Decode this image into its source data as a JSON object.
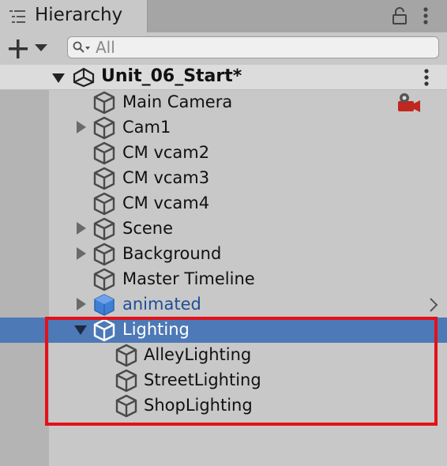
{
  "window": {
    "tab_title": "Hierarchy"
  },
  "toolbar": {
    "search_placeholder": "All"
  },
  "scene": {
    "name": "Unit_06_Start*"
  },
  "items": [
    {
      "label": "Main Camera"
    },
    {
      "label": "Cam1"
    },
    {
      "label": "CM vcam2"
    },
    {
      "label": "CM vcam3"
    },
    {
      "label": "CM vcam4"
    },
    {
      "label": "Scene"
    },
    {
      "label": "Background"
    },
    {
      "label": "Master Timeline"
    },
    {
      "label": "animated"
    },
    {
      "label": "Lighting"
    },
    {
      "label": "AlleyLighting"
    },
    {
      "label": "StreetLighting"
    },
    {
      "label": "ShopLighting"
    }
  ],
  "colors": {
    "selection": "#4d79b6",
    "prefab_text": "#1f4e9a",
    "highlight_box": "#e4101a"
  }
}
